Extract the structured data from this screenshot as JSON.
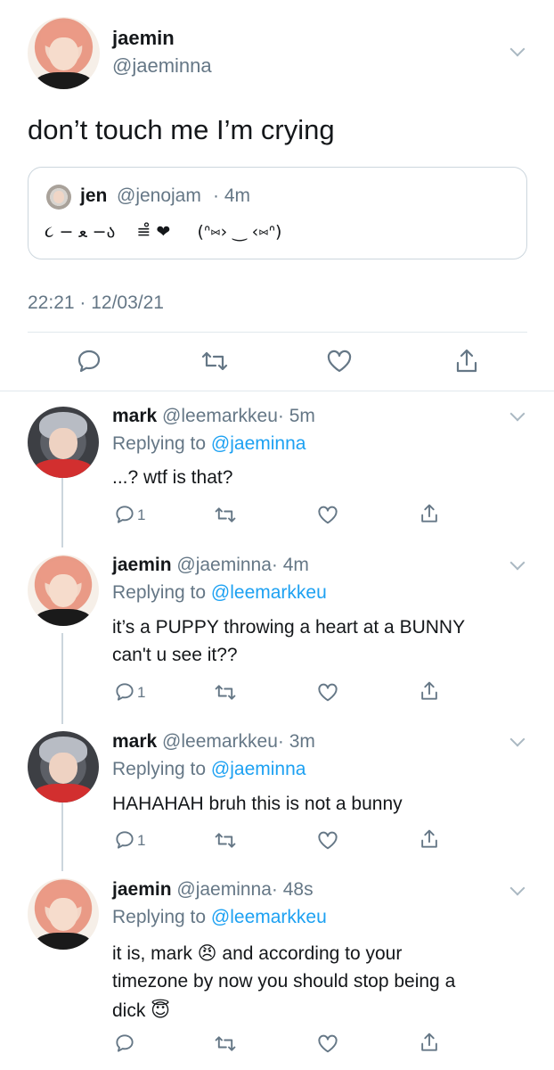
{
  "main_tweet": {
    "name": "jaemin",
    "handle": "@jaeminna",
    "text": "don’t touch me I’m crying",
    "quote": {
      "name": "jen",
      "handle": "@jenojam",
      "time": "· 4m",
      "text": "૮ − ﻌ −ა    ≡̊̊ ❤︎     (ᐢ⑅› ‿ ‹⑅ᐢ)"
    },
    "timestamp": "22:21 · 12/03/21"
  },
  "replies": [
    {
      "name": "mark",
      "handle": "@leemarkkeu",
      "time": "· 5m",
      "replying_prefix": "Replying to",
      "replying_to": "@jaeminna",
      "lines": [
        "...? wtf is that?"
      ],
      "reply_count": "1"
    },
    {
      "name": "jaemin",
      "handle": "@jaeminna",
      "time": "· 4m",
      "replying_prefix": "Replying to",
      "replying_to": "@leemarkkeu",
      "lines": [
        "it’s a PUPPY throwing a heart at a BUNNY",
        "can't u see it??"
      ],
      "reply_count": "1"
    },
    {
      "name": "mark",
      "handle": "@leemarkkeu",
      "time": "· 3m",
      "replying_prefix": "Replying to",
      "replying_to": "@jaeminna",
      "lines": [
        "HAHAHAH bruh this is not a bunny"
      ],
      "reply_count": "1"
    },
    {
      "name": "jaemin",
      "handle": "@jaeminna",
      "time": "· 48s",
      "replying_prefix": "Replying to",
      "replying_to": "@leemarkkeu",
      "lines": [
        "it is, mark 😠 and according to your",
        "timezone by now you should stop being a",
        "dick 😇"
      ],
      "reply_count": ""
    }
  ],
  "colors": {
    "link": "#1da1f2",
    "muted": "#657786",
    "border": "#e1e8ed"
  },
  "icons": [
    "chevron-down-icon",
    "reply-icon",
    "retweet-icon",
    "like-icon",
    "share-icon"
  ]
}
